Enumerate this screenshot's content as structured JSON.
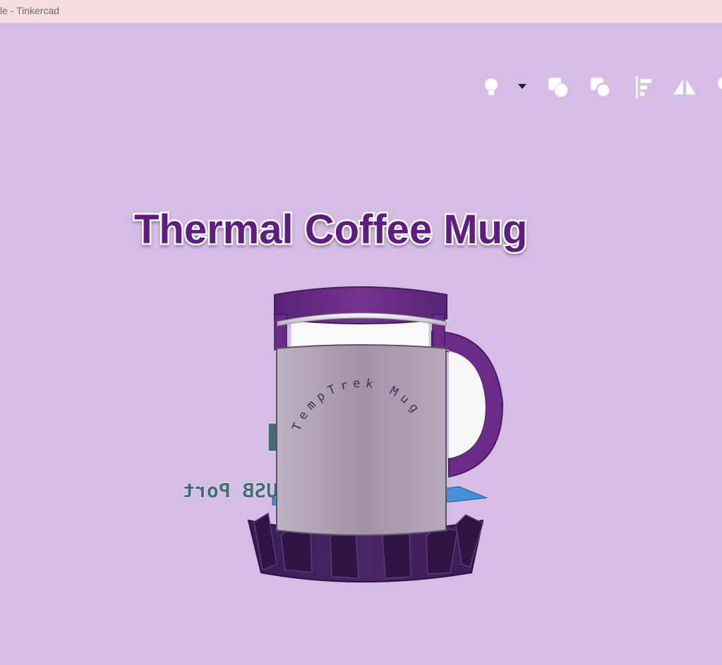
{
  "window": {
    "title": "le - Tinkercad"
  },
  "toolbar": {
    "buttons": [
      {
        "name": "light-bulb-icon",
        "interactable": true
      },
      {
        "name": "chevron-down-icon",
        "interactable": true
      },
      {
        "name": "group-shape-icon",
        "interactable": true
      },
      {
        "name": "ungroup-shape-icon",
        "interactable": true
      },
      {
        "name": "align-icon",
        "interactable": true
      },
      {
        "name": "mirror-icon",
        "interactable": true
      },
      {
        "name": "notes-icon",
        "interactable": true
      }
    ],
    "icon_color": "#ffffff"
  },
  "scene": {
    "title": "Thermal Coffee Mug",
    "sleeve_text": "TempTrek Mug",
    "port_text": "USB Port",
    "colors": {
      "background": "#d6bde6",
      "purple": "#6b2d8c",
      "dark_purple": "#3e1f5c",
      "sleeve": "#ab9aae",
      "blue_plane": "#2a8ad6",
      "title_text": "#5e1f82"
    }
  }
}
